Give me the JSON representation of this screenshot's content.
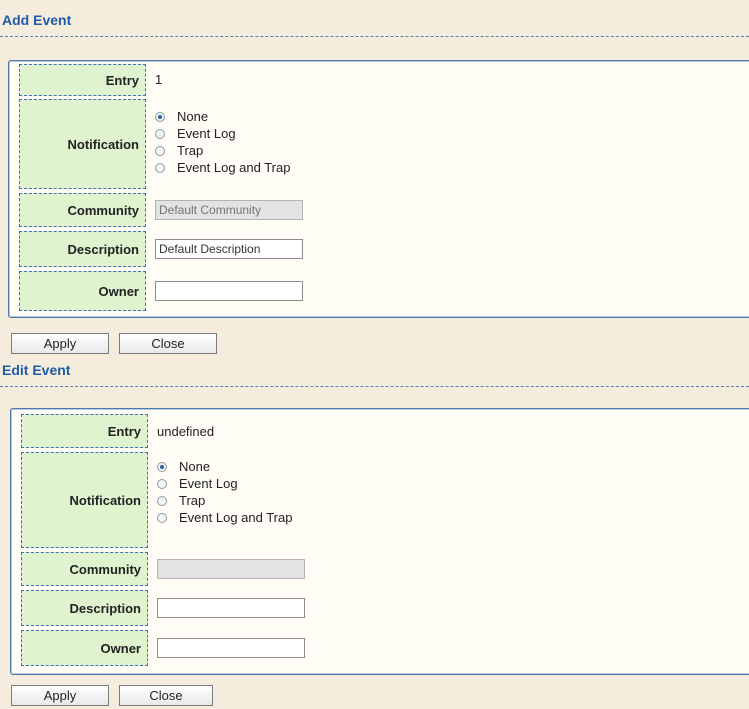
{
  "add_event": {
    "title": "Add Event",
    "entry_label": "Entry",
    "entry_value": "1",
    "notification_label": "Notification",
    "notification_options": [
      "None",
      "Event Log",
      "Trap",
      "Event Log and Trap"
    ],
    "notification_selected": "None",
    "community_label": "Community",
    "community_placeholder": "Default Community",
    "community_value": "",
    "description_label": "Description",
    "description_value": "Default Description",
    "owner_label": "Owner",
    "owner_value": "",
    "apply_label": "Apply",
    "close_label": "Close"
  },
  "edit_event": {
    "title": "Edit Event",
    "entry_label": "Entry",
    "entry_value": "undefined",
    "notification_label": "Notification",
    "notification_options": [
      "None",
      "Event Log",
      "Trap",
      "Event Log and Trap"
    ],
    "notification_selected": "None",
    "community_label": "Community",
    "community_value": "",
    "description_label": "Description",
    "description_value": "",
    "owner_label": "Owner",
    "owner_value": "",
    "apply_label": "Apply",
    "close_label": "Close"
  }
}
